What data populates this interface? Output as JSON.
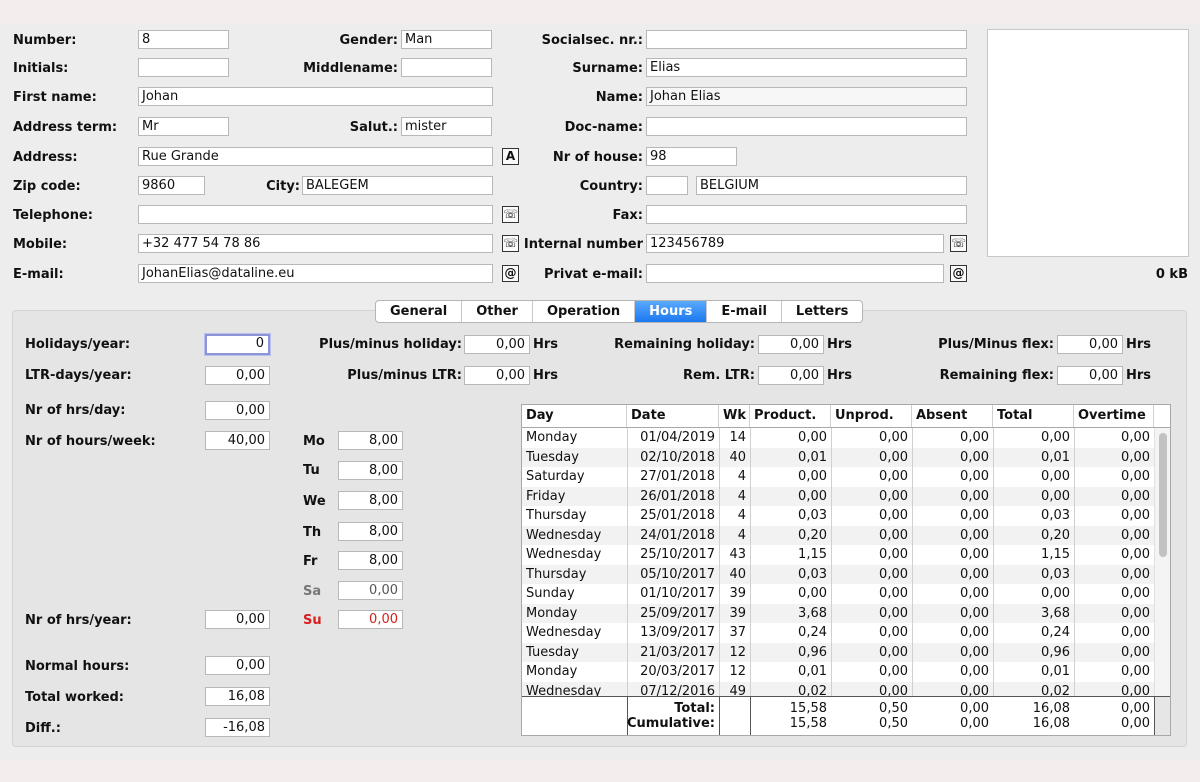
{
  "person": {
    "number_label": "Number:",
    "number": "8",
    "gender_label": "Gender:",
    "gender": "Man",
    "socialsec_label": "Socialsec. nr.:",
    "socialsec": "",
    "initials_label": "Initials:",
    "initials": "",
    "middlename_label": "Middlename:",
    "middlename": "",
    "surname_label": "Surname:",
    "surname": "Elias",
    "firstname_label": "First name:",
    "firstname": "Johan",
    "name_label": "Name:",
    "name": "Johan Elias",
    "addressterm_label": "Address term:",
    "addressterm": "Mr",
    "salut_label": "Salut.:",
    "salut": "mister",
    "docname_label": "Doc-name:",
    "docname": "",
    "address_label": "Address:",
    "address": "Rue Grande",
    "address_btn": "A",
    "houseno_label": "Nr of house:",
    "houseno": "98",
    "zip_label": "Zip code:",
    "zip": "9860",
    "city_label": "City:",
    "city": "BALEGEM",
    "country_label": "Country:",
    "country_code": "",
    "country": "BELGIUM",
    "telephone_label": "Telephone:",
    "telephone": "",
    "fax_label": "Fax:",
    "fax": "",
    "mobile_label": "Mobile:",
    "mobile": "+32 477 54 78 86",
    "internal_label": "Internal number",
    "internal": "123456789",
    "email_label": "E-mail:",
    "email": "JohanElias@dataline.eu",
    "privemail_label": "Privat e-mail:",
    "privemail": "",
    "phone_glyph": "☏",
    "at_glyph": "@",
    "photo_size": "0 kB"
  },
  "tabs": [
    {
      "label": "General"
    },
    {
      "label": "Other"
    },
    {
      "label": "Operation"
    },
    {
      "label": "Hours",
      "active": true
    },
    {
      "label": "E-mail"
    },
    {
      "label": "Letters"
    }
  ],
  "hours": {
    "holidays_label": "Holidays/year:",
    "holidays": "0",
    "ltrdays_label": "LTR-days/year:",
    "ltrdays": "0,00",
    "hrsday_label": "Nr of hrs/day:",
    "hrsday": "0,00",
    "hrsweek_label": "Nr of hours/week:",
    "hrsweek": "40,00",
    "hrsyear_label": "Nr of hrs/year:",
    "hrsyear": "0,00",
    "normal_label": "Normal hours:",
    "normal": "0,00",
    "worked_label": "Total worked:",
    "worked": "16,08",
    "diff_label": "Diff.:",
    "diff": "-16,08",
    "pm_holiday_label": "Plus/minus holiday:",
    "pm_holiday": "0,00",
    "pm_ltr_label": "Plus/minus LTR:",
    "pm_ltr": "0,00",
    "rem_holiday_label": "Remaining holiday:",
    "rem_holiday": "0,00",
    "rem_ltr_label": "Rem. LTR:",
    "rem_ltr": "0,00",
    "pm_flex_label": "Plus/Minus flex:",
    "pm_flex": "0,00",
    "rem_flex_label": "Remaining flex:",
    "rem_flex": "0,00",
    "hrs_unit": "Hrs",
    "days": [
      {
        "label": "Mo",
        "value": "8,00"
      },
      {
        "label": "Tu",
        "value": "8,00"
      },
      {
        "label": "We",
        "value": "8,00"
      },
      {
        "label": "Th",
        "value": "8,00"
      },
      {
        "label": "Fr",
        "value": "8,00"
      },
      {
        "label": "Sa",
        "value": "0,00"
      },
      {
        "label": "Su",
        "value": "0,00"
      }
    ],
    "colors": {
      "weekend_gray": "#777777",
      "sunday_red": "#d62020",
      "tab_active": "#1a78f0"
    }
  },
  "table": {
    "columns": [
      "Day",
      "Date",
      "Wk",
      "Product.",
      "Unprod.",
      "Absent",
      "Total",
      "Overtime"
    ],
    "rows": [
      [
        "Monday",
        "01/04/2019",
        "14",
        "0,00",
        "0,00",
        "0,00",
        "0,00",
        "0,00"
      ],
      [
        "Tuesday",
        "02/10/2018",
        "40",
        "0,01",
        "0,00",
        "0,00",
        "0,01",
        "0,00"
      ],
      [
        "Saturday",
        "27/01/2018",
        "4",
        "0,00",
        "0,00",
        "0,00",
        "0,00",
        "0,00"
      ],
      [
        "Friday",
        "26/01/2018",
        "4",
        "0,00",
        "0,00",
        "0,00",
        "0,00",
        "0,00"
      ],
      [
        "Thursday",
        "25/01/2018",
        "4",
        "0,03",
        "0,00",
        "0,00",
        "0,03",
        "0,00"
      ],
      [
        "Wednesday",
        "24/01/2018",
        "4",
        "0,20",
        "0,00",
        "0,00",
        "0,20",
        "0,00"
      ],
      [
        "Wednesday",
        "25/10/2017",
        "43",
        "1,15",
        "0,00",
        "0,00",
        "1,15",
        "0,00"
      ],
      [
        "Thursday",
        "05/10/2017",
        "40",
        "0,03",
        "0,00",
        "0,00",
        "0,03",
        "0,00"
      ],
      [
        "Sunday",
        "01/10/2017",
        "39",
        "0,00",
        "0,00",
        "0,00",
        "0,00",
        "0,00"
      ],
      [
        "Monday",
        "25/09/2017",
        "39",
        "3,68",
        "0,00",
        "0,00",
        "3,68",
        "0,00"
      ],
      [
        "Wednesday",
        "13/09/2017",
        "37",
        "0,24",
        "0,00",
        "0,00",
        "0,24",
        "0,00"
      ],
      [
        "Tuesday",
        "21/03/2017",
        "12",
        "0,96",
        "0,00",
        "0,00",
        "0,96",
        "0,00"
      ],
      [
        "Monday",
        "20/03/2017",
        "12",
        "0,01",
        "0,00",
        "0,00",
        "0,01",
        "0,00"
      ],
      [
        "Wednesday",
        "07/12/2016",
        "49",
        "0,02",
        "0,00",
        "0,00",
        "0,02",
        "0,00"
      ]
    ],
    "total": {
      "label": "Total:",
      "product": "15,58",
      "unprod": "0,50",
      "absent": "0,00",
      "total": "16,08",
      "overtime": "0,00"
    },
    "cumulative": {
      "label": "Cumulative:",
      "product": "15,58",
      "unprod": "0,50",
      "absent": "0,00",
      "total": "16,08",
      "overtime": "0,00"
    }
  }
}
